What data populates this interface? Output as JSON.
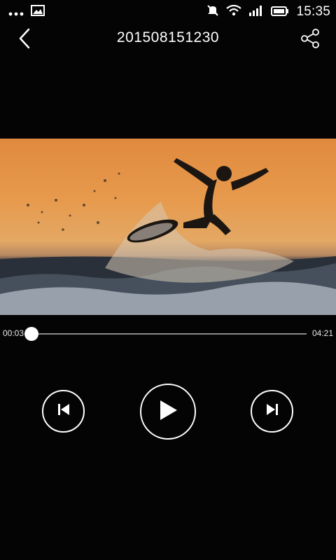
{
  "status_bar": {
    "time": "15:35",
    "icons": [
      "more-dots-icon",
      "image-icon",
      "mute-icon",
      "wifi-icon",
      "signal-icon",
      "battery-icon"
    ]
  },
  "header": {
    "title": "201508151230",
    "back_icon": "back-chevron-icon",
    "share_icon": "share-icon"
  },
  "video": {
    "description_icon": "video-frame"
  },
  "player": {
    "current_time": "00:03",
    "total_time": "04:21",
    "progress": 0.012
  },
  "controls": {
    "prev_icon": "skip-previous-icon",
    "play_icon": "play-icon",
    "next_icon": "skip-next-icon"
  }
}
